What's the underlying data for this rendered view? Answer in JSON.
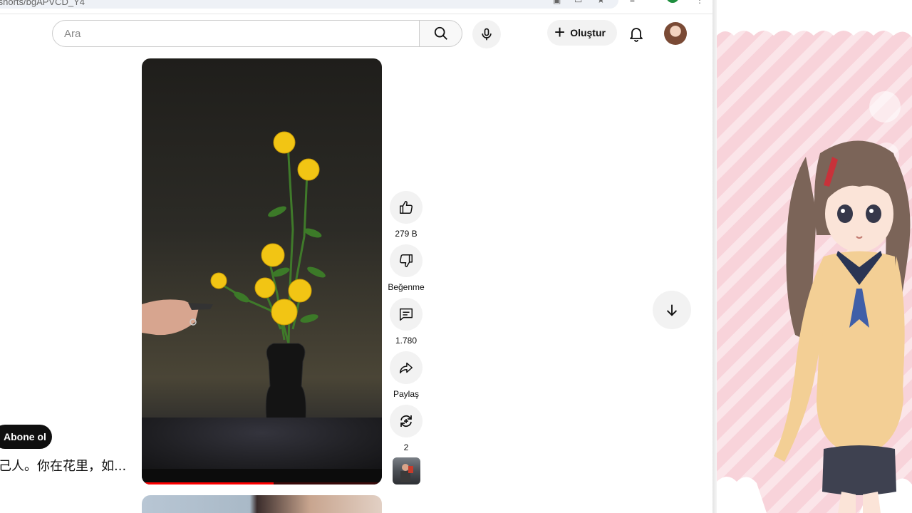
{
  "browser": {
    "url_fragment": "/shorts/bgAPVCD_Y4"
  },
  "topbar": {
    "search_placeholder": "Ara",
    "search_icon": "search-icon",
    "mic_icon": "mic-icon",
    "create_label": "Oluştur",
    "notifications_icon": "bell-icon"
  },
  "short": {
    "progress_fraction": 0.55,
    "subscribe_label": "Abone ol",
    "caption": "己人。你在花里，如..."
  },
  "actions": {
    "like_count": "279 B",
    "dislike_label": "Beğenme",
    "comment_count": "1.780",
    "share_label": "Paylaş",
    "remix_count": "2"
  },
  "colors": {
    "accent": "#ff0000",
    "button_bg": "#f2f2f2",
    "text": "#0f0f0f"
  }
}
